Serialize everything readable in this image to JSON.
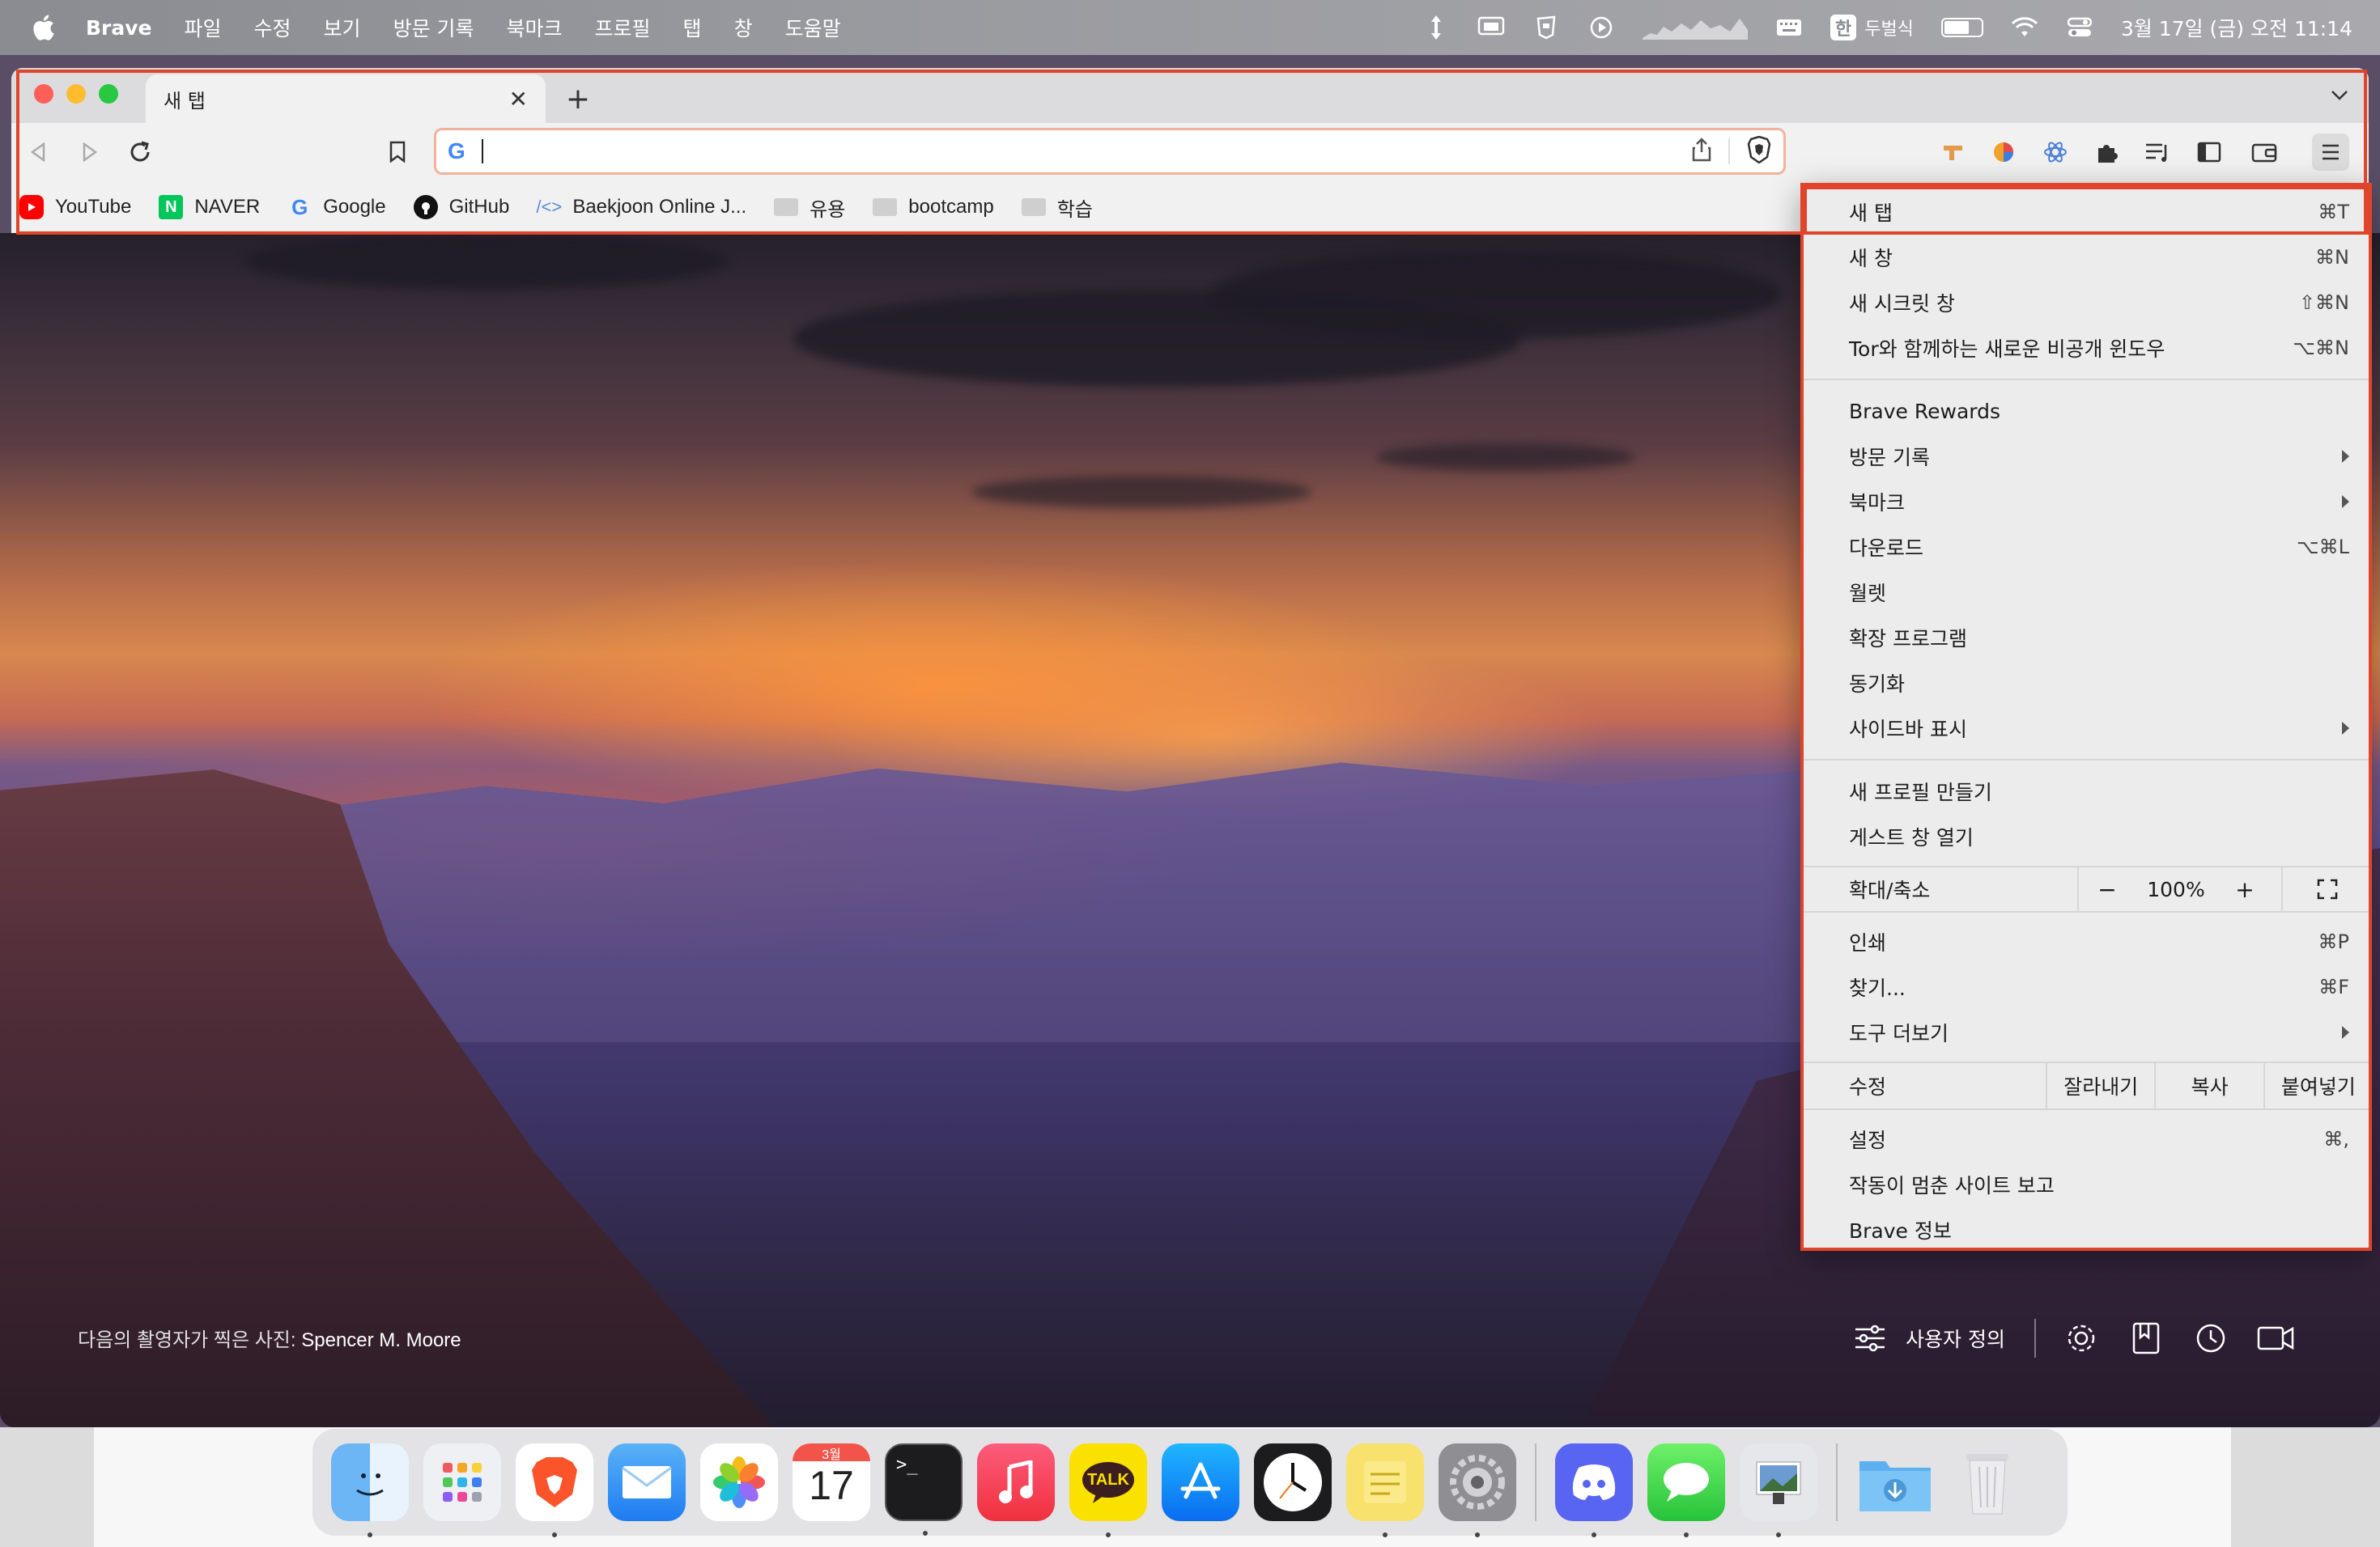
{
  "menubar": {
    "app_name": "Brave",
    "menus": [
      "파일",
      "수정",
      "보기",
      "방문 기록",
      "북마크",
      "프로필",
      "탭",
      "창",
      "도움말"
    ],
    "input_method_badge": "한",
    "input_method_name": "두벌식",
    "battery_level_percent": 68,
    "datetime": "3월 17일 (금) 오전 11:14",
    "status_icons": [
      "transfer-icon",
      "screen-mirror-icon",
      "shield-extension-icon",
      "play-icon",
      "weather-graph-icon",
      "keyboard-icon",
      "wifi-icon",
      "control-center-icon"
    ]
  },
  "browser": {
    "tab": {
      "title": "새 탭"
    },
    "omnibox": {
      "value": "",
      "placeholder": ""
    },
    "bookmarks": [
      {
        "label": "YouTube",
        "icon": "youtube-icon"
      },
      {
        "label": "NAVER",
        "icon": "naver-icon"
      },
      {
        "label": "Google",
        "icon": "google-icon"
      },
      {
        "label": "GitHub",
        "icon": "github-icon"
      },
      {
        "label": "Baekjoon Online J...",
        "icon": "code-icon"
      },
      {
        "label": "유용",
        "icon": "folder-icon"
      },
      {
        "label": "bootcamp",
        "icon": "folder-icon"
      },
      {
        "label": "학습",
        "icon": "folder-icon"
      }
    ]
  },
  "new_tab_page": {
    "photo_credit_prefix": "다음의 촬영자가 찍은 사진:",
    "photo_credit_author": "Spencer M. Moore",
    "customize_label": "사용자 정의"
  },
  "brave_menu": {
    "group1": [
      {
        "label": "새 탭",
        "shortcut": "⌘T"
      },
      {
        "label": "새 창",
        "shortcut": "⌘N"
      },
      {
        "label": "새 시크릿 창",
        "shortcut": "⇧⌘N"
      },
      {
        "label": "Tor와 함께하는 새로운 비공개 윈도우",
        "shortcut": "⌥⌘N"
      }
    ],
    "group2": [
      {
        "label": "Brave Rewards",
        "shortcut": ""
      },
      {
        "label": "방문 기록",
        "shortcut": ""
      },
      {
        "label": "북마크",
        "shortcut": ""
      },
      {
        "label": "다운로드",
        "shortcut": "⌥⌘L"
      },
      {
        "label": "월렛",
        "shortcut": ""
      },
      {
        "label": "확장 프로그램",
        "shortcut": ""
      },
      {
        "label": "동기화",
        "shortcut": ""
      },
      {
        "label": "사이드바 표시",
        "shortcut": ""
      }
    ],
    "group3": [
      {
        "label": "새 프로필 만들기"
      },
      {
        "label": "게스트 창 열기"
      }
    ],
    "zoom": {
      "label": "확대/축소",
      "minus": "−",
      "value": "100%",
      "plus": "+"
    },
    "group4": [
      {
        "label": "인쇄",
        "shortcut": "⌘P"
      },
      {
        "label": "찾기...",
        "shortcut": "⌘F"
      },
      {
        "label": "도구 더보기",
        "shortcut": ""
      }
    ],
    "edit": {
      "label": "수정",
      "cut": "잘라내기",
      "copy": "복사",
      "paste": "붙여넣기"
    },
    "group5": [
      {
        "label": "설정",
        "shortcut": "⌘,"
      },
      {
        "label": "작동이 멈춘 사이트 보고",
        "shortcut": ""
      },
      {
        "label": "Brave 정보",
        "shortcut": ""
      }
    ]
  },
  "dock": {
    "calendar_month": "3월",
    "calendar_day": "17",
    "kakao_label": "TALK",
    "apps": [
      "finder",
      "launchpad",
      "brave",
      "mail",
      "photos",
      "calendar",
      "terminal",
      "music",
      "kakaotalk",
      "app-store",
      "clock",
      "stickies",
      "system-settings",
      "discord",
      "messages",
      "preview",
      "downloads",
      "trash"
    ]
  },
  "colors": {
    "annotation": "#e0442a",
    "omnibox_border": "#f3b39a",
    "traffic_red": "#fe5f57",
    "traffic_yellow": "#febc2e",
    "traffic_green": "#28c840"
  }
}
